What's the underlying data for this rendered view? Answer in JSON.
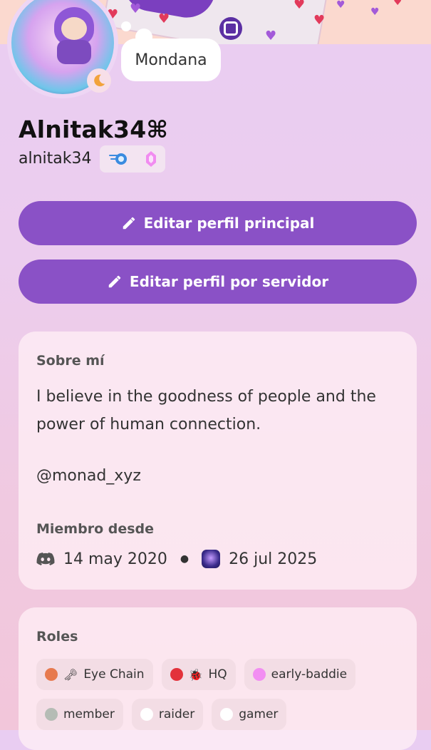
{
  "profile": {
    "status_text": "Mondana",
    "display_name": "Alnitak34⌘",
    "username": "alnitak34",
    "badges": [
      "nitro-badge-icon",
      "boost-badge-icon"
    ]
  },
  "actions": {
    "edit_main_label": "Editar perfil principal",
    "edit_server_label": "Editar perfil por servidor"
  },
  "about": {
    "heading": "Sobre mí",
    "text": "I believe in the goodness of people and the power of human connection.",
    "handle": "@monad_xyz",
    "member_since_heading": "Miembro desde",
    "discord_date": "14 may 2020",
    "server_date": "26 jul 2025"
  },
  "roles": {
    "heading": "Roles",
    "items": [
      {
        "label": "Eye Chain",
        "color": "#e77a4f",
        "emoji": "🗝"
      },
      {
        "label": "HQ",
        "color": "#e3323b",
        "emoji": "🐞"
      },
      {
        "label": "early-baddie",
        "color": "#f28ef2",
        "emoji": ""
      },
      {
        "label": "member",
        "color": "#b5bcb5",
        "emoji": ""
      },
      {
        "label": "raider",
        "color": "#ffffff",
        "emoji": ""
      },
      {
        "label": "gamer",
        "color": "#ffffff",
        "emoji": ""
      }
    ]
  },
  "colors": {
    "button": "#8a51c6",
    "accent_purple": "#7b3fbf"
  }
}
